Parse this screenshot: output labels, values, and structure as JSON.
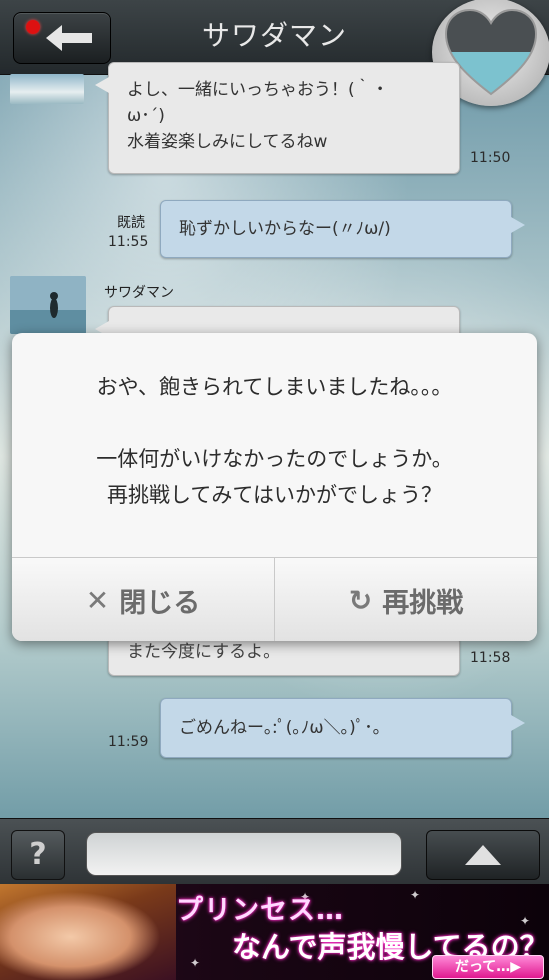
{
  "header": {
    "title": "サワダマン"
  },
  "messages": {
    "m1": {
      "lines": [
        "よし、一緒にいっちゃおう！(｀・",
        "ω･´)",
        "水着姿楽しみにしてるねw"
      ],
      "time": "11:50"
    },
    "m2": {
      "read": "既読",
      "time": "11:55",
      "text": "恥ずかしいからなー(〃ﾉω/)"
    },
    "m3": {
      "sender": "サワダマン"
    },
    "m4": {
      "partial": "また今度にするよ。",
      "time": "11:58"
    },
    "m5": {
      "time": "11:59",
      "text": "ごめんねー｡:ﾟ(｡ﾉω＼｡)ﾟ･｡"
    }
  },
  "dialog": {
    "line1": "おや、飽きられてしまいましたね。。。",
    "line2": "",
    "line3": "一体何がいけなかったのでしょうか。",
    "line4": "再挑戦してみてはいかがでしょう？",
    "close_icon": "✕",
    "close_label": "閉じる",
    "retry_icon": "↻",
    "retry_label": "再挑戦"
  },
  "inputbar": {
    "help": "?"
  },
  "ad": {
    "line1": "プリンセス…",
    "line2": "なんで声我慢してるの？",
    "cta": "だって…▶"
  },
  "icons": {
    "back": "back-arrow-icon",
    "heart": "heart-gauge-icon",
    "send": "up-arrow-icon"
  },
  "colors": {
    "accent_pink": "#e0198f",
    "bubble_out": "#c3d8e8",
    "bubble_in": "#e9e9e9"
  }
}
